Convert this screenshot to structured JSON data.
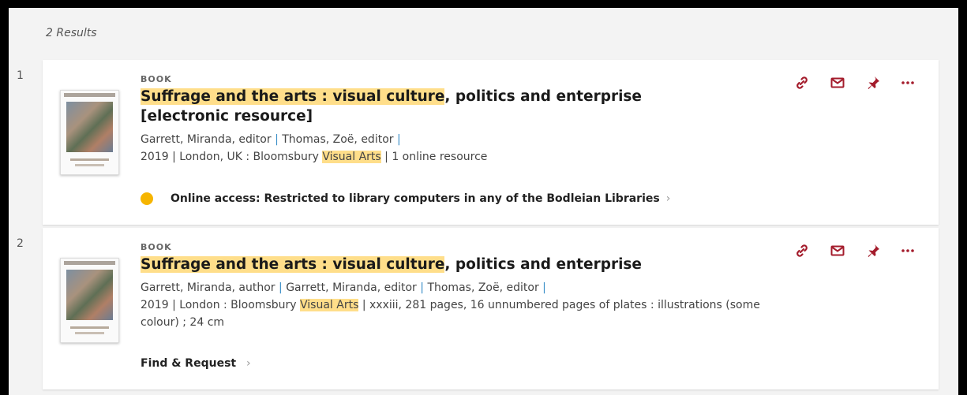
{
  "results_count": "2 Results",
  "colors": {
    "accent": "#a41c2c",
    "highlight": "#ffde8a",
    "separator": "#3b8fc8",
    "availability_dot": "#f6b500"
  },
  "results": [
    {
      "index": "1",
      "type": "BOOK",
      "title_highlight": "Suffrage and the arts : visual culture",
      "title_rest": ", politics and enterprise [electronic resource]",
      "contributors": [
        "Garrett, Miranda, editor",
        "Thomas, Zoë, editor"
      ],
      "pub_pre": "2019 | London, UK : Bloomsbury ",
      "pub_highlight": "Visual Arts",
      "pub_post": " | 1 online resource",
      "availability": "Online access: Restricted to library computers in any of the Bodleian Libraries",
      "actions": [
        "link-icon",
        "email-icon",
        "pin-icon",
        "more-icon"
      ]
    },
    {
      "index": "2",
      "type": "BOOK",
      "title_highlight": "Suffrage and the arts : visual culture",
      "title_rest": ", politics and enterprise",
      "contributors": [
        "Garrett, Miranda, author",
        "Garrett, Miranda, editor",
        "Thomas, Zoë, editor"
      ],
      "pub_pre": "2019 | London : Bloomsbury ",
      "pub_highlight": "Visual Arts",
      "pub_post": " | xxxiii, 281 pages, 16 unnumbered pages of plates : illustrations (some colour) ; 24 cm",
      "find_label": "Find & Request",
      "actions": [
        "link-icon",
        "email-icon",
        "pin-icon",
        "more-icon"
      ]
    }
  ]
}
